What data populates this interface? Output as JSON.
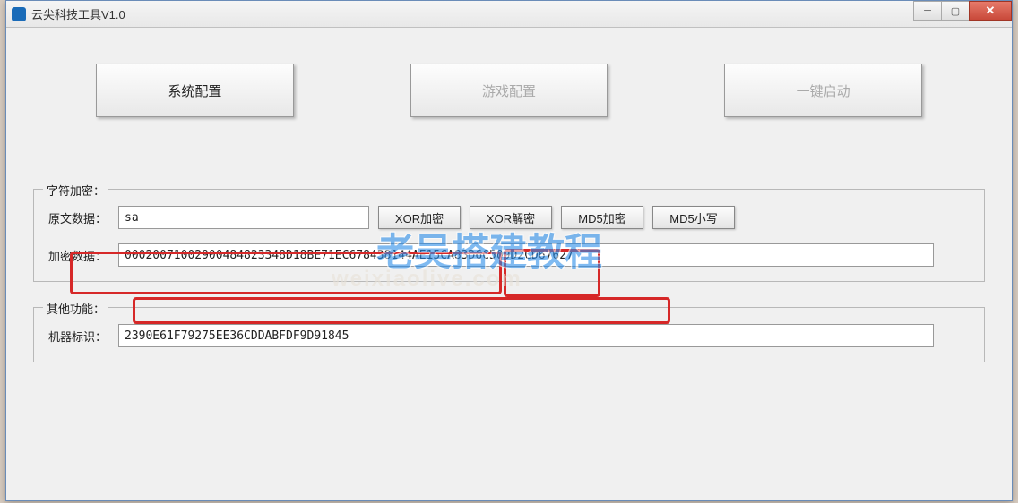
{
  "window": {
    "title": "云尖科技工具V1.0"
  },
  "tabs": {
    "system_config": "系统配置",
    "game_config": "游戏配置",
    "one_key_start": "一键启动"
  },
  "encrypt_group": {
    "title": "字符加密：",
    "plain_label": "原文数据：",
    "plain_value": "sa",
    "xor_encrypt": "XOR加密",
    "xor_decrypt": "XOR解密",
    "md5_encrypt": "MD5加密",
    "md5_lower": "MD5小写",
    "cipher_label": "加密数据：",
    "cipher_value": "00020071002900484823348D18BE71EC678438144AE15CA83D6C509D2CD67627"
  },
  "other_group": {
    "title": "其他功能：",
    "machine_label": "机器标识：",
    "machine_value": "2390E61F79275EE36CDDABFDF9D91845"
  },
  "watermark": {
    "cn": "老吴搭建教程",
    "en": "weixiaolive.com"
  }
}
